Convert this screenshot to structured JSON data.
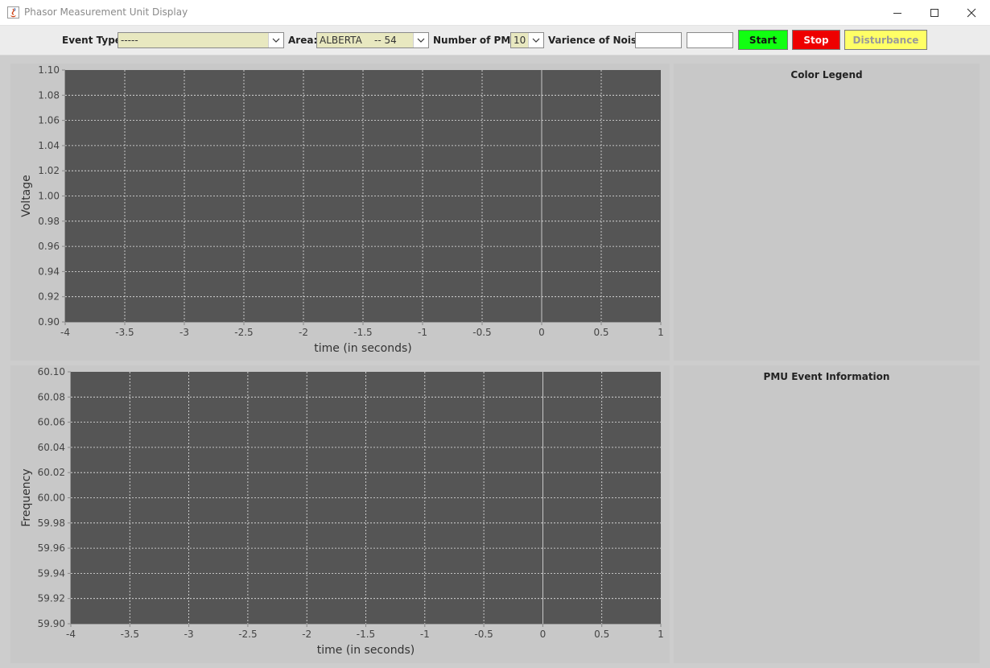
{
  "window": {
    "title": "Phasor Measurement Unit Display",
    "controls": [
      "minimize-icon",
      "maximize-icon",
      "close-icon"
    ]
  },
  "toolbar": {
    "event_type_label": "Event Type:",
    "event_type_value": "-----",
    "area_label": "Area:",
    "area_value": "ALBERTA    -- 54",
    "pmu_count_label": "Number of PMU:",
    "pmu_count_value": "10",
    "noise_label": "Varience of Noise:",
    "noise_value_1": "",
    "noise_value_2": "",
    "start_label": "Start",
    "stop_label": "Stop",
    "disturbance_label": "Disturbance",
    "colors": {
      "start_bg": "#11ff11",
      "stop_bg": "#ee0000",
      "disturbance_bg": "#ffff66",
      "combo_bg": "#e8e8c0"
    }
  },
  "side_panels": {
    "legend_title": "Color Legend",
    "event_info_title": "PMU Event Information"
  },
  "chart_data": [
    {
      "type": "line",
      "title": "",
      "xlabel": "time (in seconds)",
      "ylabel": "Voltage",
      "xlim": [
        -4,
        1
      ],
      "ylim": [
        0.9,
        1.1
      ],
      "x_ticks": [
        "-4",
        "-3.5",
        "-3",
        "-2.5",
        "-2",
        "-1.5",
        "-1",
        "-0.5",
        "0",
        "0.5",
        "1"
      ],
      "y_ticks": [
        "1.10",
        "1.08",
        "1.06",
        "1.04",
        "1.02",
        "1.00",
        "0.98",
        "0.96",
        "0.94",
        "0.92",
        "0.90"
      ],
      "grid": true,
      "plot_bg": "#555555",
      "series": []
    },
    {
      "type": "line",
      "title": "",
      "xlabel": "time (in seconds)",
      "ylabel": "Frequency",
      "xlim": [
        -4,
        1
      ],
      "ylim": [
        59.9,
        60.1
      ],
      "x_ticks": [
        "-4",
        "-3.5",
        "-3",
        "-2.5",
        "-2",
        "-1.5",
        "-1",
        "-0.5",
        "0",
        "0.5",
        "1"
      ],
      "y_ticks": [
        "60.10",
        "60.08",
        "60.06",
        "60.04",
        "60.02",
        "60.00",
        "59.98",
        "59.96",
        "59.94",
        "59.92",
        "59.90"
      ],
      "grid": true,
      "plot_bg": "#555555",
      "series": []
    }
  ]
}
